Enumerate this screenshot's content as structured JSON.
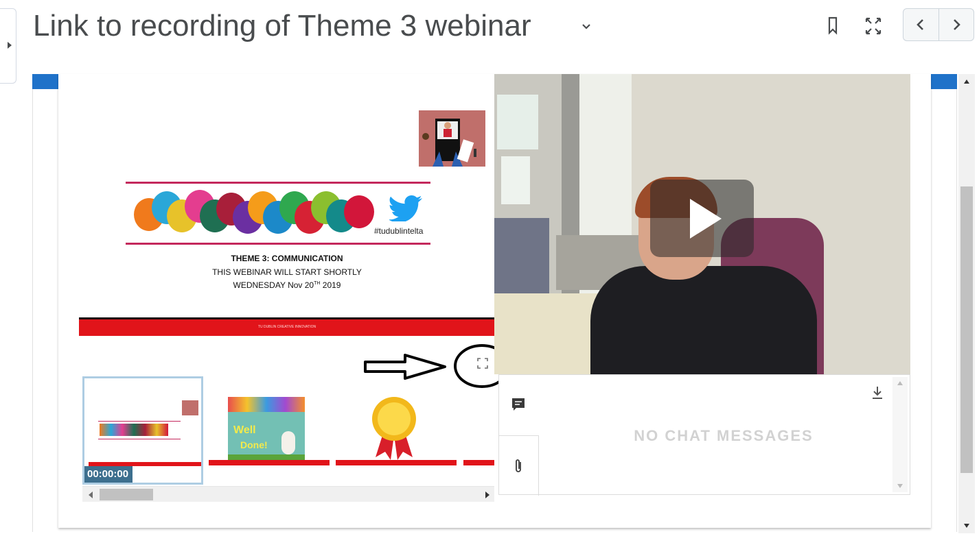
{
  "header": {
    "title": "Link to recording of Theme 3 webinar",
    "icons": [
      "caret-right-icon",
      "chevron-down-icon",
      "bookmark-icon",
      "expand-icon",
      "chevron-left-icon",
      "chevron-right-icon"
    ]
  },
  "slide": {
    "hashtag": "#tudublintelta",
    "theme_title": "THEME 3: COMMUNICATION",
    "subtitle": "THIS WEBINAR WILL START SHORTLY",
    "date_prefix": "WEDNESDAY Nov 20",
    "date_sup": "TH",
    "date_year": " 2019",
    "footer_text": "TU DUBLIN CREATIVE INNOVATION"
  },
  "thumbnails": {
    "timestamp": "00:00:00",
    "thumb_text_1": "Well",
    "thumb_text_2": "Done!"
  },
  "chat": {
    "empty_message": "NO CHAT MESSAGES"
  },
  "colors": {
    "brand_blue": "#1f72c9",
    "slide_red": "#e1141a",
    "timestamp_bg": "#3d6f8e"
  }
}
